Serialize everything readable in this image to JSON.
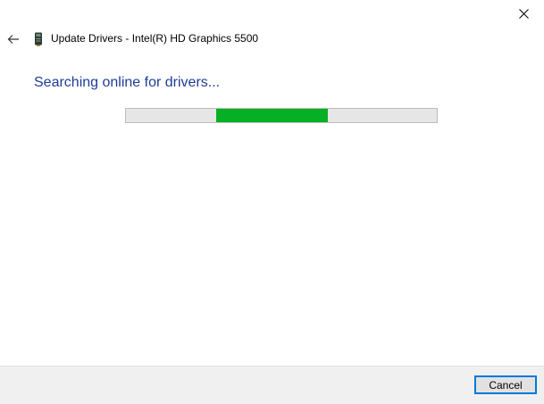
{
  "window": {
    "close_icon": "close-icon"
  },
  "header": {
    "back_icon": "back-arrow-icon",
    "device_icon": "graphics-card-icon",
    "title": "Update Drivers - Intel(R) HD Graphics 5500"
  },
  "main": {
    "status": "Searching online for drivers...",
    "progress": {
      "mode": "indeterminate-marquee",
      "chunk_start_fraction": 0.29,
      "chunk_end_fraction": 0.65,
      "color": "#06b025"
    }
  },
  "footer": {
    "cancel_label": "Cancel"
  },
  "colors": {
    "heading": "#1e3c96",
    "accent": "#0078d7",
    "footer_bg": "#f0f0f0"
  }
}
